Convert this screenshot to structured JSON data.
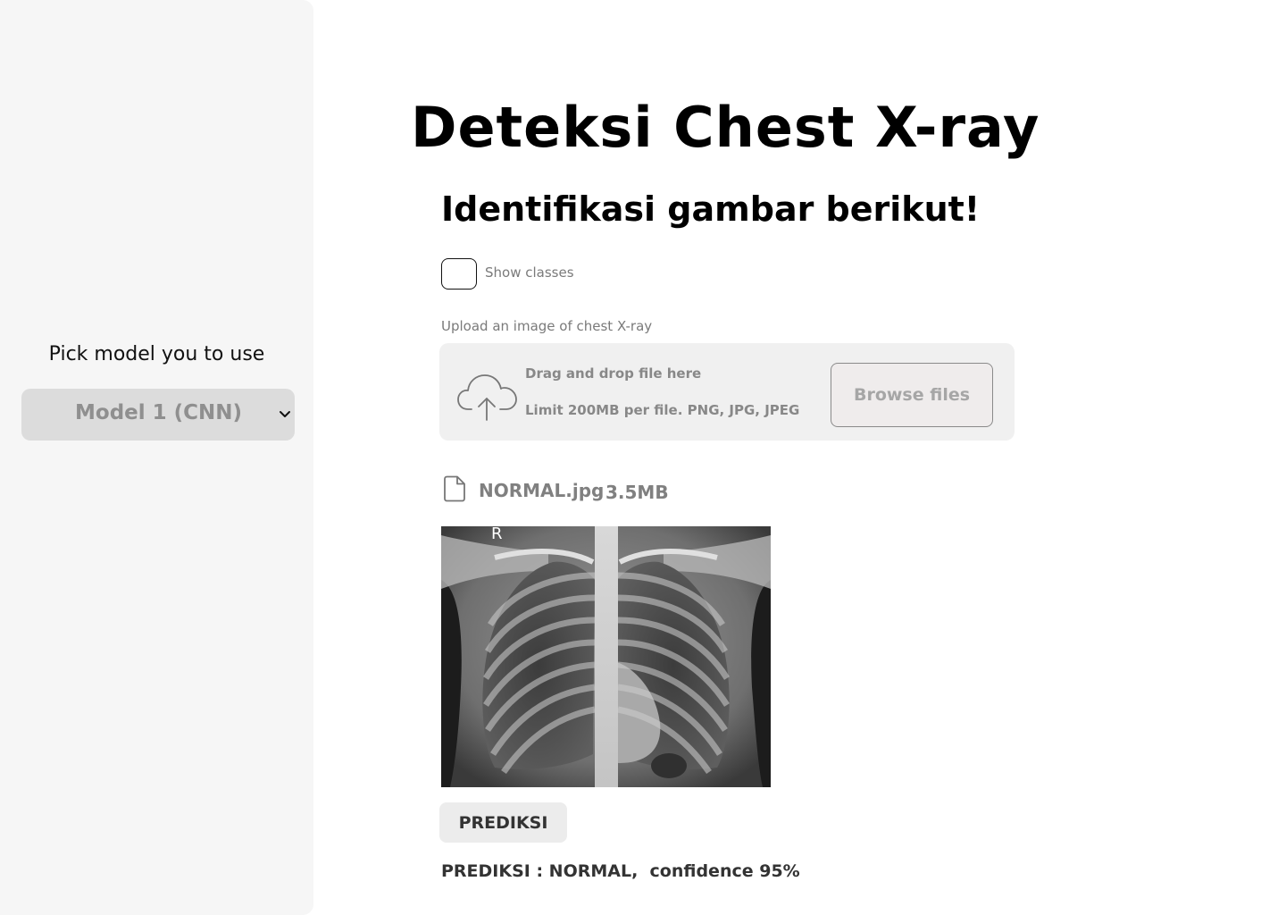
{
  "sidebar": {
    "label": "Pick model you to use",
    "model_select": {
      "value": "Model 1 (CNN)"
    }
  },
  "main": {
    "title": "Deteksi Chest X-ray",
    "subtitle": "Identifikasi gambar berikut!",
    "show_classes": {
      "label": "Show classes",
      "checked": false
    },
    "uploader": {
      "label": "Upload an image of chest X-ray",
      "drop_text": "Drag and drop file here",
      "limit_text": "Limit 200MB per file. PNG, JPG, JPEG",
      "browse_label": "Browse files"
    },
    "file": {
      "name": "NORMAL.jpg",
      "size": "3.5MB"
    },
    "image": {
      "marker": "R"
    },
    "predict_button": "PREDIKSI",
    "result": "PREDIKSI : NORMAL,  confidence 95%"
  },
  "icons": [
    "chevron-down-icon",
    "cloud-upload-icon",
    "file-icon"
  ]
}
